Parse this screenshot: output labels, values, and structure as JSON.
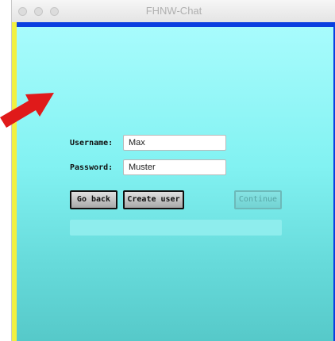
{
  "window": {
    "title": "FHNW-Chat"
  },
  "colors": {
    "top_bar": "#0b3fe0",
    "left_bar": "#f2f040",
    "arrow": "#e01a1a",
    "background_top": "#a9fcfd",
    "background_bottom": "#56c9c9"
  },
  "form": {
    "username_label": "Username:",
    "username_value": "Max",
    "password_label": "Password:",
    "password_value": "Muster"
  },
  "buttons": {
    "go_back": "Go back",
    "create_user": "Create user",
    "continue": "Continue"
  },
  "status": {
    "message": ""
  },
  "decorations": {
    "arrow_icon": "red-arrow-icon"
  }
}
